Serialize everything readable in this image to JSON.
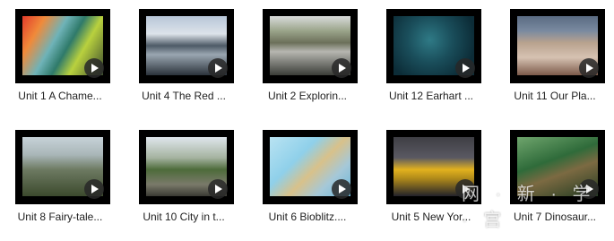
{
  "videos": [
    {
      "title": "Unit 1 A Chame...",
      "thumbnail": "chameleon-image",
      "color": "#e23b2a"
    },
    {
      "title": "Unit 4 The Red ...",
      "thumbnail": "mountain-clouds-image",
      "color": "#4d5a66"
    },
    {
      "title": "Unit 2 Explorin...",
      "thumbnail": "river-valley-image",
      "color": "#6c705a"
    },
    {
      "title": "Unit 12 Earhart ...",
      "thumbnail": "underwater-wreck-image",
      "color": "#1a4e5b"
    },
    {
      "title": "Unit 11 Our Pla...",
      "thumbnail": "crowd-image",
      "color": "#b8a28e"
    },
    {
      "title": "Unit 8 Fairy-tale...",
      "thumbnail": "castle-image",
      "color": "#6d7a62"
    },
    {
      "title": "Unit 10 City in t...",
      "thumbnail": "machu-picchu-image",
      "color": "#4d6b3a"
    },
    {
      "title": "Unit 6 Bioblitz....",
      "thumbnail": "map-image",
      "color": "#8fd0ea"
    },
    {
      "title": "Unit 5 New Yor...",
      "thumbnail": "yellow-taxi-image",
      "color": "#e2b21e"
    },
    {
      "title": "Unit 7 Dinosaur...",
      "thumbnail": "dinosaur-image",
      "color": "#2f6b3a"
    }
  ],
  "watermark": "网 · 新 · 学 · 宫"
}
